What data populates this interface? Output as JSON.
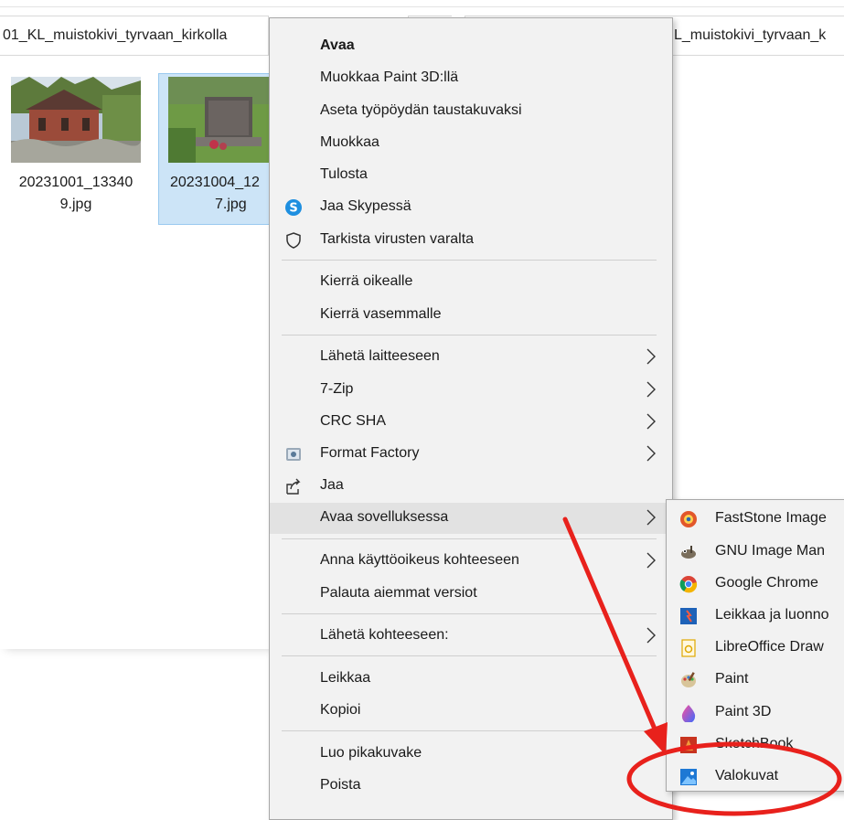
{
  "explorer": {
    "path_left": "01_KL_muistokivi_tyrvaan_kirkolla",
    "path_right": "L_muistokivi_tyrvaan_k",
    "files": [
      {
        "name_line1": "20231001_13340",
        "name_line2": "9.jpg",
        "selected": false
      },
      {
        "name_line1": "20231004_12",
        "name_line2": "7.jpg",
        "selected": true
      }
    ]
  },
  "context_menu": {
    "items": [
      {
        "label": "Avaa",
        "bold": true
      },
      {
        "label": "Muokkaa Paint 3D:llä"
      },
      {
        "label": "Aseta työpöydän taustakuvaksi"
      },
      {
        "label": "Muokkaa"
      },
      {
        "label": "Tulosta"
      },
      {
        "label": "Jaa Skypessä",
        "icon": "skype-icon"
      },
      {
        "label": "Tarkista virusten varalta",
        "icon": "shield-icon"
      },
      {
        "label": "Kierrä oikealle"
      },
      {
        "label": "Kierrä vasemmalle"
      },
      {
        "label": "Lähetä laitteeseen",
        "submenu": true
      },
      {
        "label": "7-Zip",
        "submenu": true
      },
      {
        "label": "CRC SHA",
        "submenu": true
      },
      {
        "label": "Format Factory",
        "icon": "format-factory-icon",
        "submenu": true
      },
      {
        "label": "Jaa",
        "icon": "share-icon"
      },
      {
        "label": "Avaa sovelluksessa",
        "submenu": true,
        "highlighted": true
      },
      {
        "label": "Anna käyttöoikeus kohteeseen",
        "submenu": true
      },
      {
        "label": "Palauta aiemmat versiot"
      },
      {
        "label": "Lähetä kohteeseen:",
        "submenu": true
      },
      {
        "label": "Leikkaa"
      },
      {
        "label": "Kopioi"
      },
      {
        "label": "Luo pikakuvake"
      },
      {
        "label": "Poista"
      }
    ]
  },
  "open_with_submenu": {
    "items": [
      {
        "label": "FastStone Image",
        "icon": "faststone-icon"
      },
      {
        "label": "GNU Image Man",
        "icon": "gimp-icon"
      },
      {
        "label": "Google Chrome",
        "icon": "chrome-icon"
      },
      {
        "label": "Leikkaa ja luonno",
        "icon": "snip-sketch-icon"
      },
      {
        "label": "LibreOffice Draw",
        "icon": "libreoffice-draw-icon"
      },
      {
        "label": "Paint",
        "icon": "paint-icon"
      },
      {
        "label": "Paint 3D",
        "icon": "paint3d-icon"
      },
      {
        "label": "SketchBook",
        "icon": "sketchbook-icon"
      },
      {
        "label": "Valokuvat",
        "icon": "photos-icon",
        "circled": true
      }
    ]
  },
  "annotation": {
    "arrow_color": "#e8211c",
    "circle_color": "#e8211c"
  },
  "colors": {
    "menu_bg": "#f2f2f2",
    "highlight": "#e2e2e2",
    "selection": "#cce4f7"
  }
}
